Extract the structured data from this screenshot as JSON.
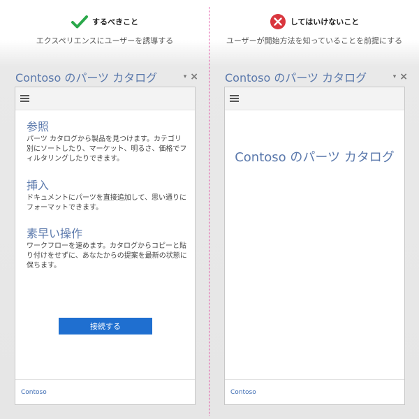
{
  "left": {
    "verdict": "するべきこと",
    "subtitle": "エクスペリエンスにユーザーを誘導する",
    "pane_title": "Contoso のパーツ カタログ",
    "sections": [
      {
        "heading": "参照",
        "body": "パーツ カタログから製品を見つけます。カテゴリ別にソートしたり、マーケット、明るさ、価格でフィルタリングしたりできます。"
      },
      {
        "heading": "挿入",
        "body": "ドキュメントにパーツを直接追加して、思い通りにフォーマットできます。"
      },
      {
        "heading": "素早い操作",
        "body": "ワークフローを速めます。カタログからコピーと貼り付けをせずに、あなたからの提案を最新の状態に保ちます。"
      }
    ],
    "button_label": "接続する",
    "footer": "Contoso"
  },
  "right": {
    "verdict": "してはいけないこと",
    "subtitle": "ユーザーが開始方法を知っていることを前提にする",
    "pane_title": "Contoso のパーツ カタログ",
    "center_title": "Contoso のパーツ カタログ",
    "footer": "Contoso"
  },
  "colors": {
    "accent_blue": "#5b79ac",
    "button_blue": "#1f6fd0",
    "check_green": "#2aa84a",
    "x_red": "#d9363e",
    "divider_pink": "#e04aa0"
  },
  "icons": {
    "do": "check-icon",
    "dont": "x-icon",
    "menu": "hamburger-icon",
    "pane_dropdown": "chevron-down-icon",
    "pane_close": "close-icon"
  }
}
